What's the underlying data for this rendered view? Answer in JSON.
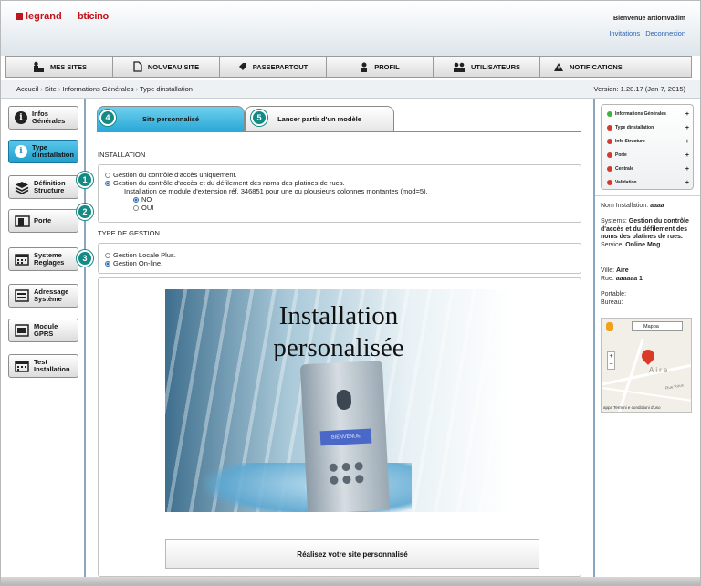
{
  "header": {
    "logo_legrand": "legrand",
    "logo_bticino": "bticino",
    "welcome": "Bienvenue artiomvadim",
    "link_invitations": "Invitations",
    "link_deconnexion": "Deconnexion"
  },
  "nav": [
    {
      "label": "MES SITES",
      "icon": "building-icon"
    },
    {
      "label": "NOUVEAU SITE",
      "icon": "new-document-icon"
    },
    {
      "label": "PASSEPARTOUT",
      "icon": "tag-icon"
    },
    {
      "label": "PROFIL",
      "icon": "user-icon"
    },
    {
      "label": "UTILISATEURS",
      "icon": "users-icon"
    },
    {
      "label": "NOTIFICATIONS",
      "icon": "warning-icon"
    }
  ],
  "breadcrumb": {
    "items": [
      "Accueil",
      "Site",
      "Informations Générales",
      "Type dinstallation"
    ],
    "sep": "›",
    "version": "Version: 1.28.17 (Jan 7, 2015)"
  },
  "sidebar": [
    {
      "label": "Infos Générales",
      "l1": "Infos",
      "l2": "Générales",
      "icon": "info-icon",
      "active": false
    },
    {
      "label": "Type d'installation",
      "l1": "Type",
      "l2": "d'installation",
      "icon": "info-icon",
      "active": true
    },
    {
      "label": "Définition Structure",
      "l1": "Définition",
      "l2": "Structure",
      "icon": "layers-icon",
      "active": false
    },
    {
      "label": "Porte",
      "l1": "Porte",
      "l2": "",
      "icon": "door-icon",
      "active": false
    },
    {
      "label": "Systeme Reglages",
      "l1": "Systeme",
      "l2": "Reglages",
      "icon": "calendar-icon",
      "active": false
    },
    {
      "label": "Adressage Système",
      "l1": "Adressage",
      "l2": "Système",
      "icon": "address-icon",
      "active": false
    },
    {
      "label": "Module GPRS",
      "l1": "Module",
      "l2": "GPRS",
      "icon": "module-icon",
      "active": false
    },
    {
      "label": "Test Installation",
      "l1": "Test",
      "l2": "Installation",
      "icon": "calendar-icon",
      "active": false
    }
  ],
  "tabs": {
    "tab1": {
      "label": "Site personnalisé",
      "num": "4"
    },
    "tab2": {
      "label": "Lancer partir d'un modèle",
      "num": "5"
    }
  },
  "installation": {
    "section": "INSTALLATION",
    "opt1": "Gestion du contrôle d'accès uniquement.",
    "opt2": "Gestion du contrôle d'accès et du défilement des noms des platines de rues.",
    "module_text": "Installation de module d'extension réf. 346851 pour une ou plousieurs colonnes montantes (mod=5).",
    "no": "NO",
    "oui": "OUI",
    "selected": "opt2",
    "module_selected": "NO"
  },
  "gestion": {
    "section": "TYPE DE GESTION",
    "opt1": "Gestion Locale Plus.",
    "opt2": "Gestion On-line.",
    "selected": "opt2"
  },
  "callouts": [
    "1",
    "2",
    "3"
  ],
  "promo": {
    "line1": "Installation",
    "line2": "personalisée",
    "screen": "BIENVENUE",
    "cta": "Réalisez votre site personnalisé"
  },
  "status_panel": [
    {
      "label": "Informations Générales",
      "color": "#3fb23f"
    },
    {
      "label": "Type dinstallation",
      "color": "#d23a2f"
    },
    {
      "label": "Info Structure",
      "color": "#d23a2f"
    },
    {
      "label": "Porte",
      "color": "#d23a2f"
    },
    {
      "label": "Centrale",
      "color": "#d23a2f"
    },
    {
      "label": "Validation",
      "color": "#d23a2f"
    }
  ],
  "plus": "+",
  "info": {
    "nom_label": "Nom Installation:",
    "nom_value": "aaaa",
    "systems_label": "Systems:",
    "systems_value": "Gestion du contrôle d'accès et du défilement des noms des platines de rues.",
    "service_label": "Service:",
    "service_value": "Online Mng",
    "ville_label": "Ville:",
    "ville_value": "Aire",
    "rue_label": "Rue:",
    "rue_value": "aaaaaa 1",
    "portable_label": "Portable:",
    "bureau_label": "Bureau:"
  },
  "map": {
    "type": "Mappa",
    "city": "Aire",
    "street": "Rue Roux",
    "footer": "appa   Termini e condizioni d'uso"
  },
  "colors": {
    "accent": "#29a8d6",
    "callout": "#158a85",
    "link": "#2a64b5"
  }
}
